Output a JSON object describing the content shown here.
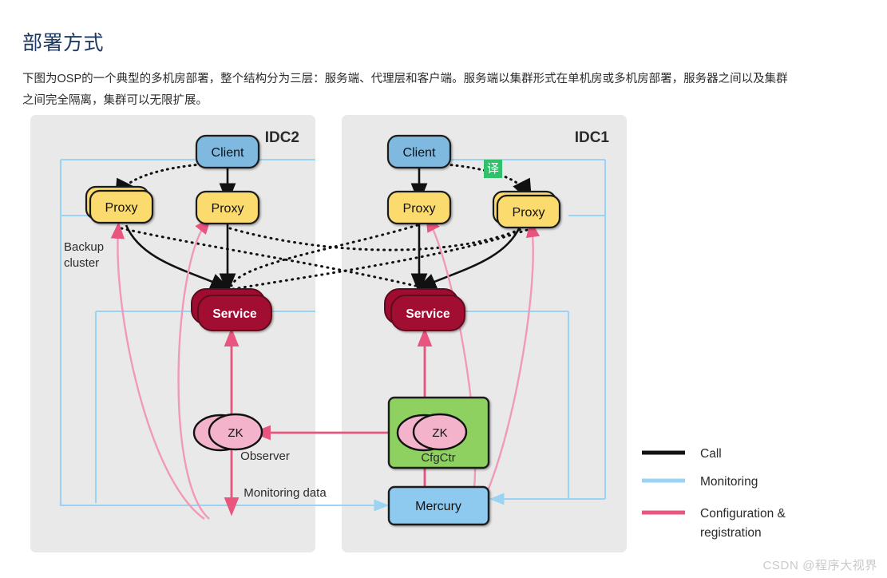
{
  "article": {
    "title": "部署方式",
    "paragraph": "下图为OSP的一个典型的多机房部署，整个结构分为三层：服务端、代理层和客户端。服务端以集群形式在单机房或多机房部署，服务器之间以及集群之间完全隔离，集群可以无限扩展。"
  },
  "watermark": "CSDN @程序大视界",
  "diagram": {
    "type": "architecture-deployment-diagram",
    "panels": [
      {
        "id": "idc2",
        "label": "IDC2"
      },
      {
        "id": "idc1",
        "label": "IDC1"
      }
    ],
    "annotations": {
      "backup_cluster": "Backup\ncluster",
      "backup_cluster_line1": "Backup",
      "backup_cluster_line2": "cluster",
      "observer": "Observer",
      "cfgctr": "CfgCtr",
      "monitoring_data": "Monitoring data",
      "translate_badge": "译"
    },
    "nodes": {
      "idc2": {
        "client": "Client",
        "proxy_backup": "Proxy",
        "proxy_main": "Proxy",
        "service": "Service",
        "zk": "ZK"
      },
      "idc1": {
        "client": "Client",
        "proxy_main": "Proxy",
        "proxy_backup": "Proxy",
        "service": "Service",
        "zk": "ZK",
        "mercury": "Mercury"
      }
    },
    "legend": {
      "items": [
        {
          "key": "call",
          "label": "Call",
          "color": "#111111"
        },
        {
          "key": "monitoring",
          "label": "Monitoring",
          "color": "#9ad4f2"
        },
        {
          "key": "configuration",
          "label": "Configuration &",
          "label2": "registration",
          "color": "#e8557f"
        }
      ]
    },
    "colors": {
      "panel_bg": "#e9e9e9",
      "client": "#7fb9e0",
      "proxy": "#fbdb6e",
      "service": "#a20b31",
      "zk": "#f3b4cb",
      "cfgctr": "#8ed160",
      "mercury": "#8ecaf0",
      "call": "#111111",
      "monitoring": "#9ad4f2",
      "configuration": "#e8557f",
      "badge": "#2fc16c",
      "title": "#1f3a63"
    }
  }
}
